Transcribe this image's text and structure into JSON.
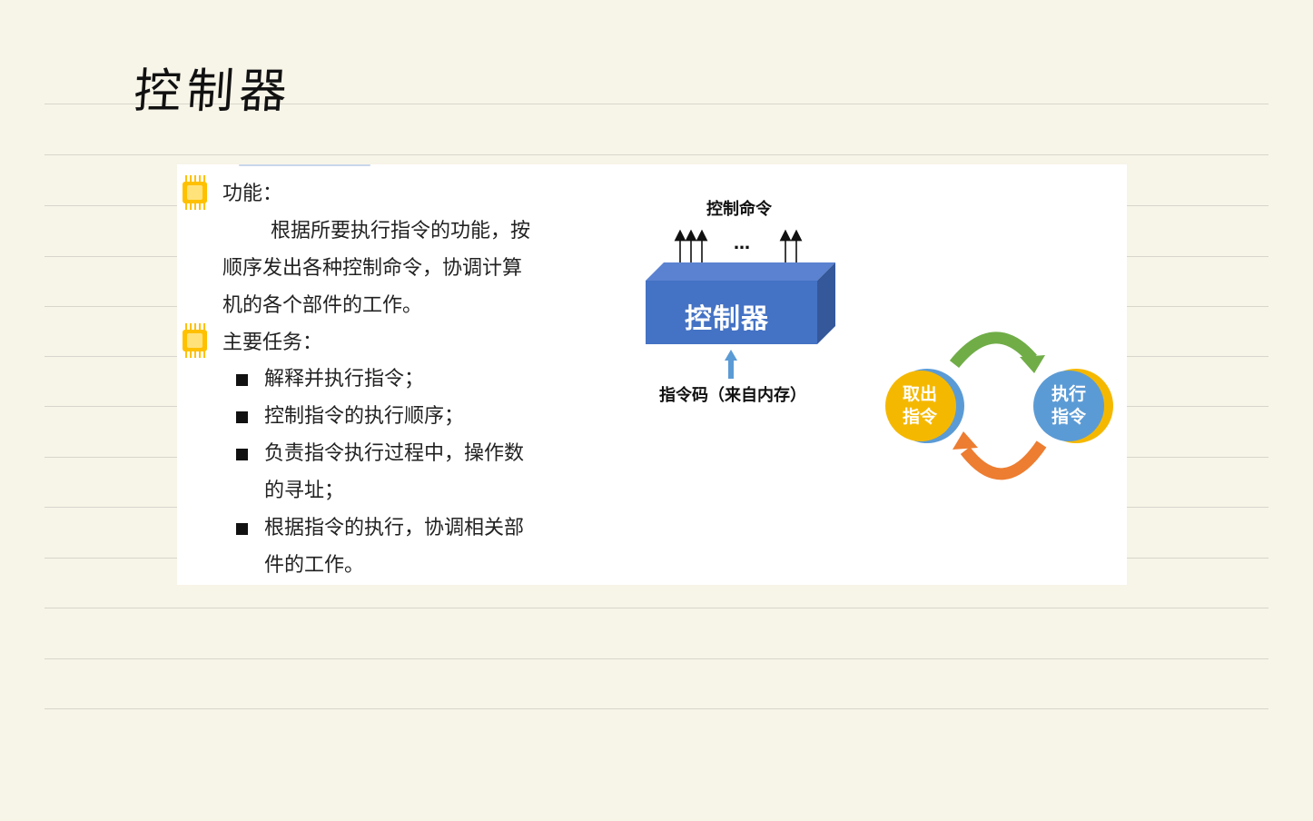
{
  "page_title": "控制器",
  "slide": {
    "function_heading": "功能：",
    "function_lines": [
      "根据所要执行指令的功能，按",
      "顺序发出各种控制命令，协调计算",
      "机的各个部件的工作。"
    ],
    "tasks_heading": "主要任务：",
    "tasks": [
      {
        "lines": [
          "解释并执行指令；"
        ]
      },
      {
        "lines": [
          "控制指令的执行顺序；"
        ]
      },
      {
        "lines": [
          "负责指令执行过程中，操作数",
          "的寻址；"
        ]
      },
      {
        "lines": [
          "根据指令的执行，协调相关部",
          "件的工作。"
        ]
      }
    ],
    "diagram": {
      "top_label": "控制命令",
      "ellipsis": "…",
      "box_label": "控制器",
      "bottom_label": "指令码（来自内存）"
    },
    "cycle": {
      "fetch_line1": "取出",
      "fetch_line2": "指令",
      "exec_line1": "执行",
      "exec_line2": "指令"
    }
  },
  "colors": {
    "background": "#f7f4e8",
    "box_front": "#4472c4",
    "box_top": "#5b82d0",
    "box_side": "#35589a",
    "arrow_blue": "#5b9bd5",
    "circle_yellow": "#f5b800",
    "circle_blue": "#5b9bd5",
    "arc_green": "#70ad47",
    "arc_orange": "#ed7d31",
    "chip": "#ffc000"
  }
}
